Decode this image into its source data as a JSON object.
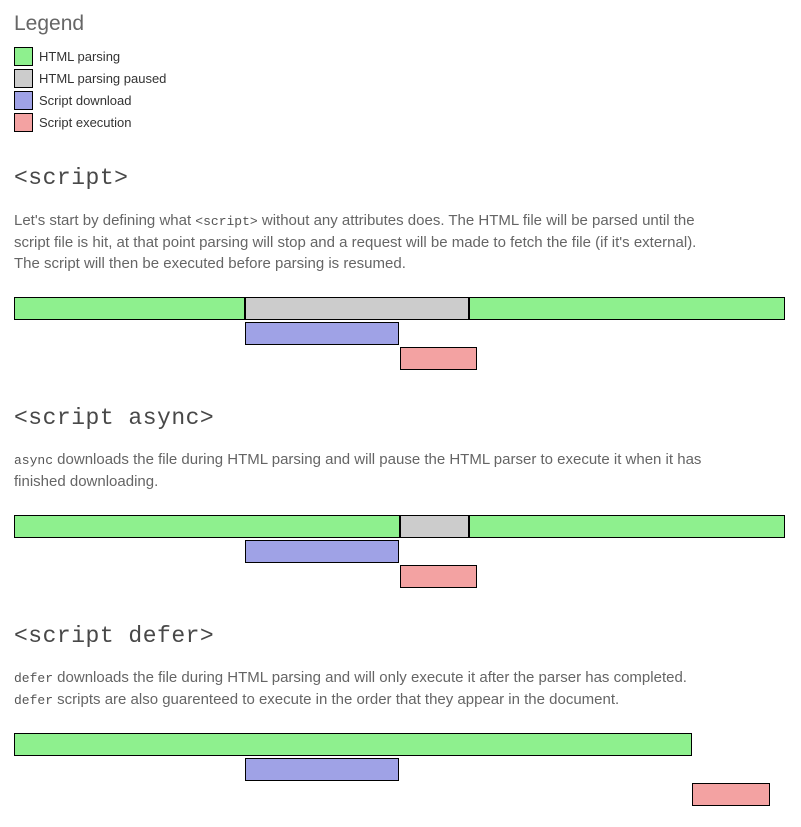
{
  "legend": {
    "title": "Legend",
    "items": [
      {
        "label": "HTML parsing",
        "color": "#8ef08e"
      },
      {
        "label": "HTML parsing paused",
        "color": "#cccccc"
      },
      {
        "label": "Script download",
        "color": "#9fa2e6"
      },
      {
        "label": "Script execution",
        "color": "#f3a2a2"
      }
    ]
  },
  "colors": {
    "parse": "#8ef08e",
    "paused": "#cccccc",
    "download": "#9fa2e6",
    "execute": "#f3a2a2"
  },
  "sections": [
    {
      "heading": "<script>",
      "desc_parts": [
        "Let's start by defining what ",
        "<script>",
        " without any attributes does. The HTML file will be parsed until the script file is hit, at that point parsing will stop and a request will be made to fetch the file (if it's external). The script will then be executed before parsing is resumed."
      ],
      "tracks": [
        [
          {
            "kind": "parse",
            "start": 0,
            "end": 30
          },
          {
            "kind": "paused",
            "start": 30,
            "end": 59
          },
          {
            "kind": "parse",
            "start": 59,
            "end": 100
          }
        ],
        [
          {
            "kind": "download",
            "start": 30,
            "end": 50
          }
        ],
        [
          {
            "kind": "execute",
            "start": 50,
            "end": 60
          }
        ]
      ]
    },
    {
      "heading": "<script async>",
      "desc_parts": [
        "async",
        " downloads the file during HTML parsing and will pause the HTML parser to execute it when it has finished downloading."
      ],
      "tracks": [
        [
          {
            "kind": "parse",
            "start": 0,
            "end": 50
          },
          {
            "kind": "paused",
            "start": 50,
            "end": 59
          },
          {
            "kind": "parse",
            "start": 59,
            "end": 100
          }
        ],
        [
          {
            "kind": "download",
            "start": 30,
            "end": 50
          }
        ],
        [
          {
            "kind": "execute",
            "start": 50,
            "end": 60
          }
        ]
      ]
    },
    {
      "heading": "<script defer>",
      "desc_parts": [
        "defer",
        " downloads the file during HTML parsing and will only execute it after the parser has completed. ",
        "defer",
        " scripts are also guarenteed to execute in the order that they appear in the document."
      ],
      "tracks": [
        [
          {
            "kind": "parse",
            "start": 0,
            "end": 88
          }
        ],
        [
          {
            "kind": "download",
            "start": 30,
            "end": 50
          }
        ],
        [
          {
            "kind": "execute",
            "start": 88,
            "end": 98
          }
        ]
      ]
    }
  ]
}
